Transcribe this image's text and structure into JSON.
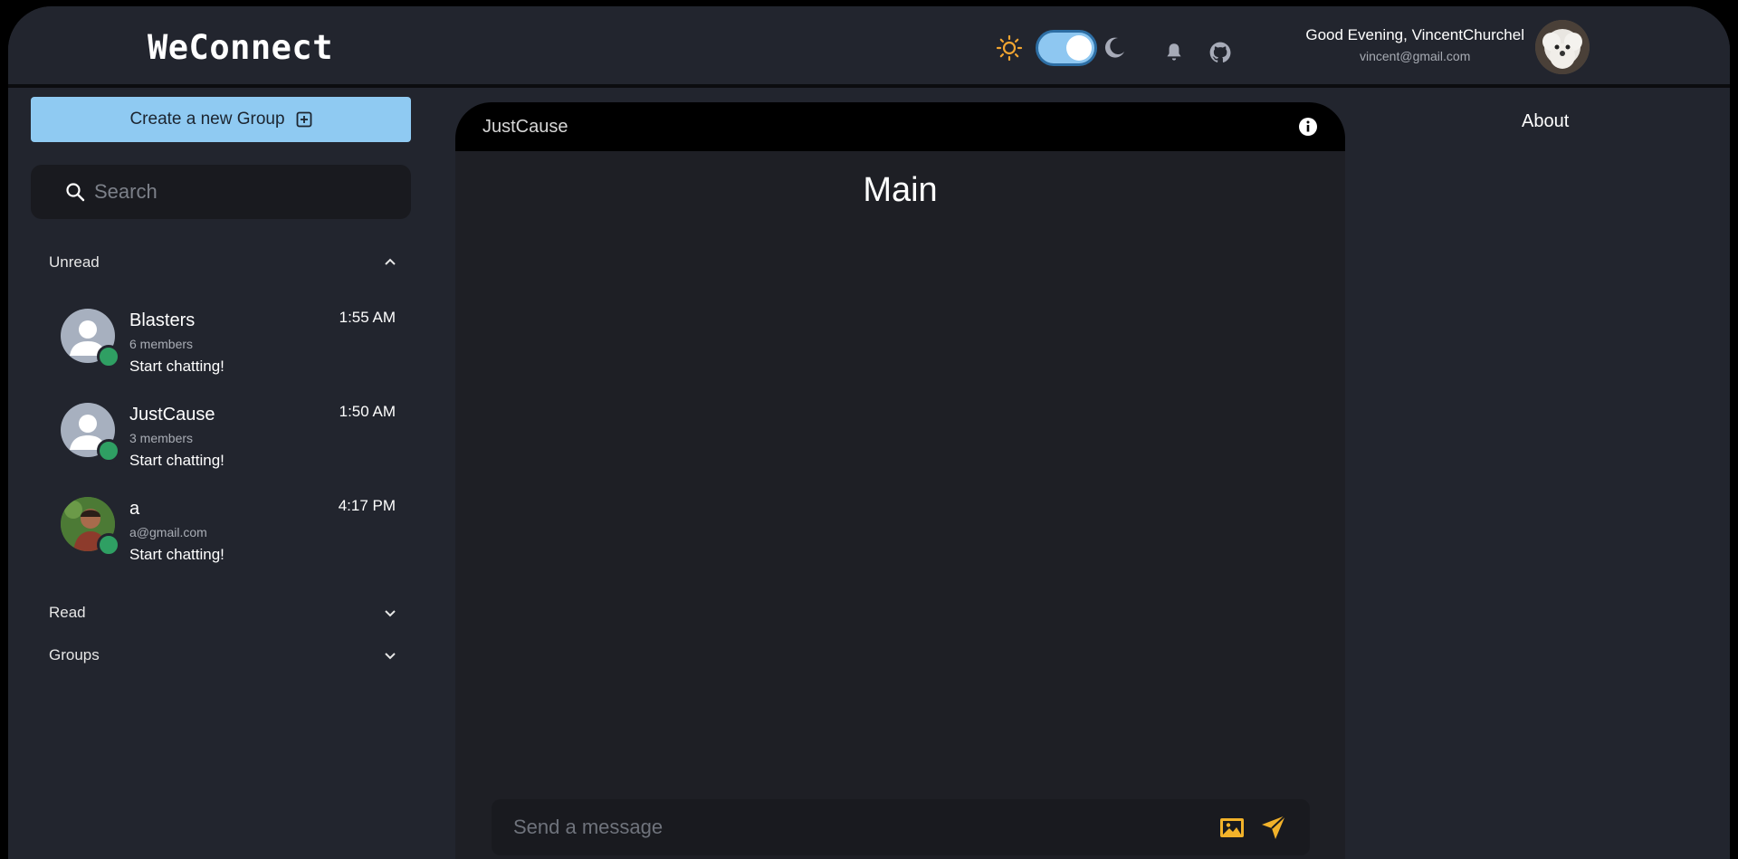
{
  "app": {
    "brand": "WeConnect"
  },
  "header": {
    "greeting": "Good Evening, VincentChurchel",
    "email": "vincent@gmail.com",
    "theme_icons": [
      "sun-icon",
      "moon-icon"
    ],
    "icons": [
      "bell-icon",
      "github-icon"
    ]
  },
  "sidebar": {
    "create_label": "Create a new Group",
    "search_placeholder": "Search",
    "sections": {
      "unread": "Unread",
      "read": "Read",
      "groups": "Groups"
    },
    "chats": [
      {
        "name": "Blasters",
        "sub": "6 members",
        "message": "Start chatting!",
        "time": "1:55 AM"
      },
      {
        "name": "JustCause",
        "sub": "3 members",
        "message": "Start chatting!",
        "time": "1:50 AM"
      },
      {
        "name": "a",
        "sub": "a@gmail.com",
        "message": "Start chatting!",
        "time": "4:17 PM"
      }
    ]
  },
  "chat": {
    "title": "JustCause",
    "channel": "Main",
    "composer_placeholder": "Send a message"
  },
  "about": {
    "label": "About"
  },
  "colors": {
    "accent": "#8fcaf2",
    "online": "#2f9f63",
    "icon_yellow": "#f2b22a",
    "background": "#22252e"
  }
}
